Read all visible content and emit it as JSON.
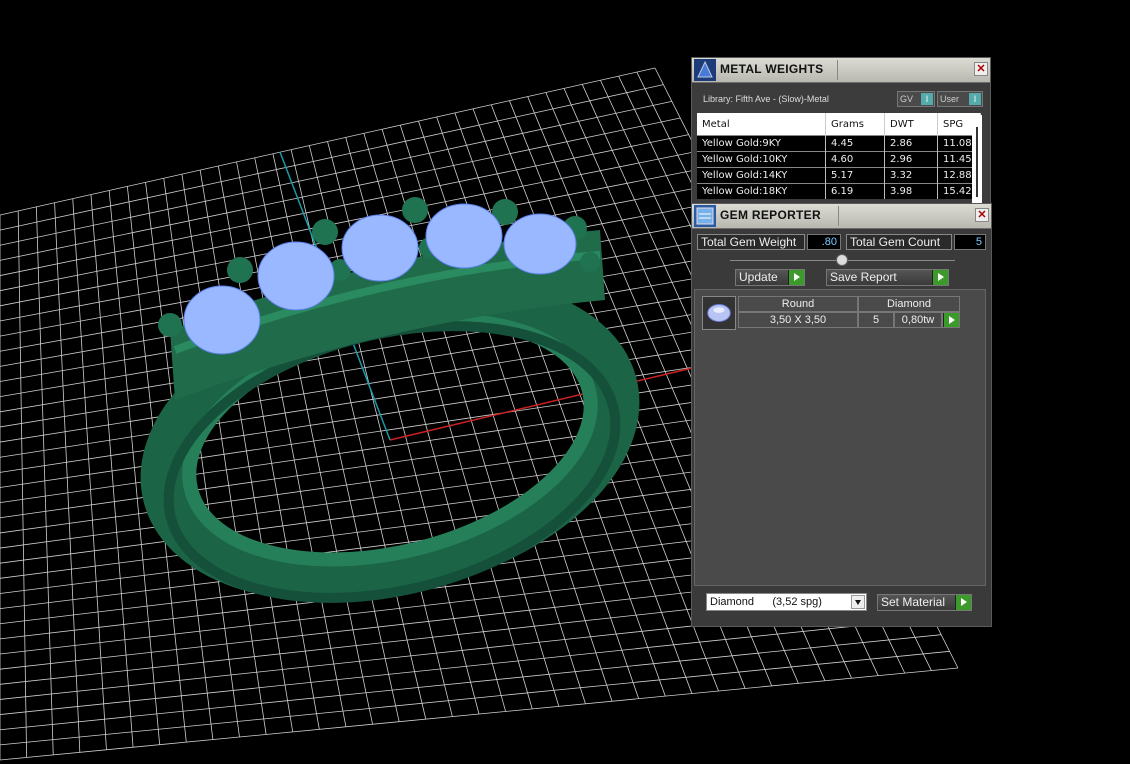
{
  "metal_weights": {
    "title": "METAL WEIGHTS",
    "library_label": "Library: Fifth Ave - (Slow)-Metal",
    "toggle_gv": "GV",
    "toggle_user": "User",
    "toggle_glyph": "I",
    "columns": [
      "Metal",
      "Grams",
      "DWT",
      "SPG"
    ],
    "rows": [
      [
        "Yellow Gold:9KY",
        "4.45",
        "2.86",
        "11.08"
      ],
      [
        "Yellow Gold:10KY",
        "4.60",
        "2.96",
        "11.45"
      ],
      [
        "Yellow Gold:14KY",
        "5.17",
        "3.32",
        "12.88"
      ],
      [
        "Yellow Gold:18KY",
        "6.19",
        "3.98",
        "15.42"
      ]
    ],
    "close_glyph": "✕"
  },
  "gem_reporter": {
    "title": "GEM REPORTER",
    "total_gem_weight_label": "Total Gem Weight",
    "total_gem_weight_value": ".80",
    "total_gem_count_label": "Total Gem Count",
    "total_gem_count_value": "5",
    "update_label": "Update",
    "save_report_label": "Save Report",
    "gem_row": {
      "shape": "Round",
      "material": "Diamond",
      "size": "3,50 X 3,50",
      "count": "5",
      "weight": "0,80tw"
    },
    "material_select": "Diamond      (3,52 spg)",
    "set_material_label": "Set Material",
    "close_glyph": "✕"
  },
  "icons": [
    "metal-weights-icon",
    "gem-reporter-icon",
    "gem-thumbnail-icon",
    "close-icon",
    "dropdown-arrow-icon",
    "collapse-toggle-icon"
  ],
  "colors": {
    "ring": "#1f6b4a",
    "gem": "#9ab8ff",
    "grid": "#d8d8d8",
    "axis_x": "#cc2222",
    "axis_y": "#1a9aa8",
    "go_button": "#3c9a2a"
  }
}
